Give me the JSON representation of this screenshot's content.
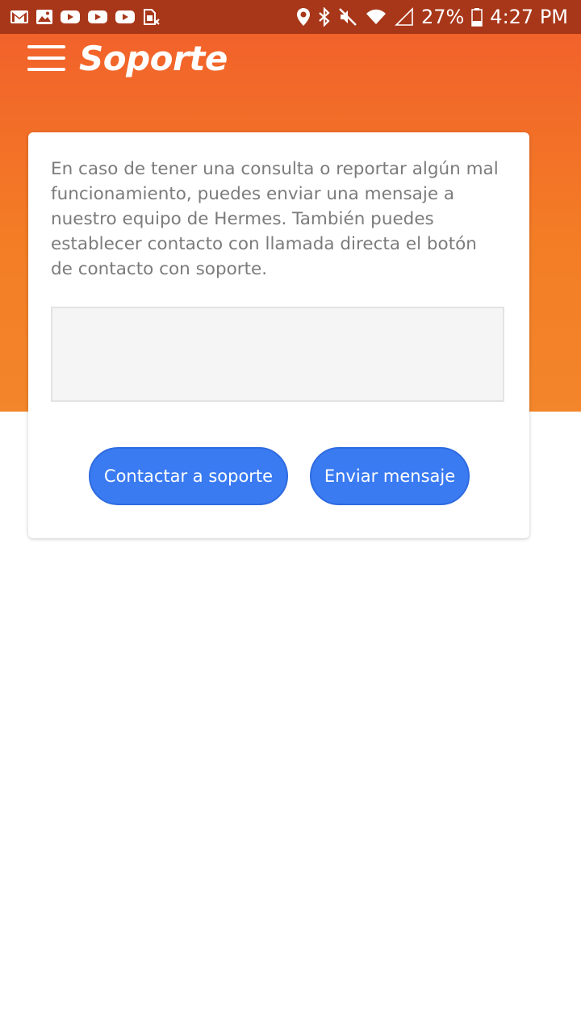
{
  "status_bar": {
    "battery_percent": "27%",
    "time": "4:27 PM",
    "left_icons": [
      "gmail-icon",
      "image-icon",
      "youtube-icon",
      "youtube-icon",
      "youtube-icon",
      "sim-card-icon"
    ],
    "right_icons": [
      "location-icon",
      "bluetooth-icon",
      "mute-icon",
      "wifi-icon",
      "signal-icon",
      "battery-icon"
    ]
  },
  "header": {
    "title": "Soporte",
    "menu_icon": "hamburger-menu-icon"
  },
  "card": {
    "description": "En caso de tener una consulta o reportar algún mal funcionamiento, puedes enviar una mensaje a nuestro equipo de Hermes. También puedes establecer contacto con llamada directa el botón de contacto con soporte.",
    "message_value": "",
    "contact_button_label": "Contactar a soporte",
    "send_button_label": "Enviar mensaje"
  },
  "colors": {
    "status_bar": "#a8371a",
    "header_gradient_top": "#f2622b",
    "header_gradient_bottom": "#f3852a",
    "button": "#3a7bf2",
    "text_muted": "#7b7b7b"
  }
}
